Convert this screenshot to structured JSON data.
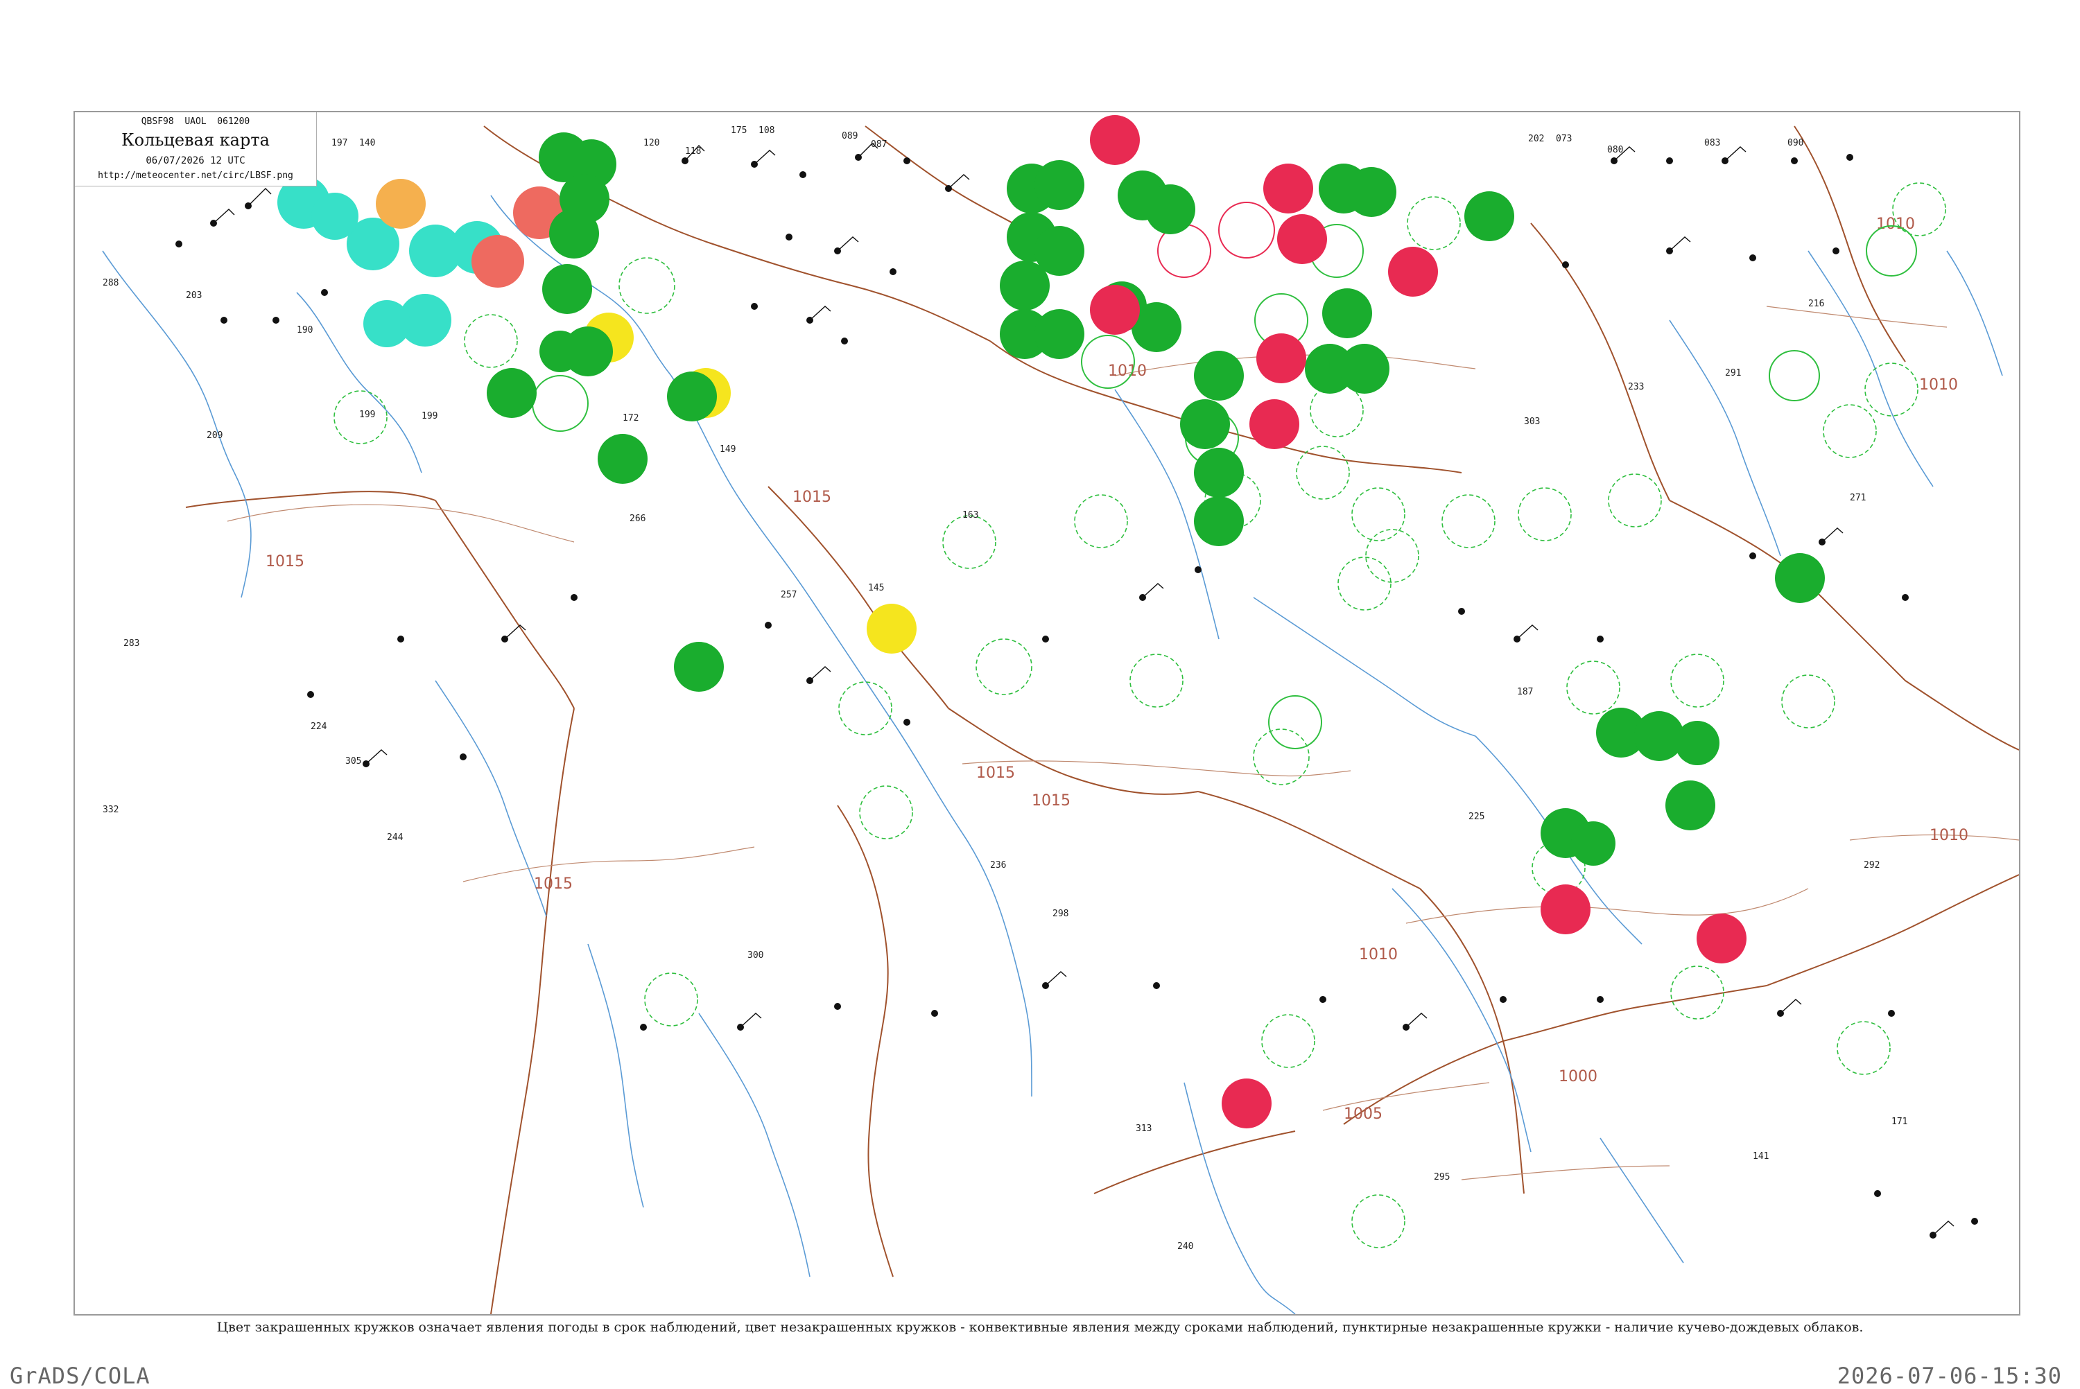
{
  "header": {
    "code_line": "QBSF98  UAOL  061200",
    "title": "Кольцевая карта",
    "datetime": "06/07/2026 12 UTC",
    "url": "http://meteocenter.net/circ/LBSF.png"
  },
  "caption": "Цвет закрашенных кружков означает явления погоды в срок наблюдений, цвет незакрашенных кружков - конвективные явления между сроками наблюдений, пунктирные незакрашенные кружки - наличие кучево-дождевых облаков.",
  "footer": {
    "left": "GrADS/COLA",
    "right": "2026-07-06-15:30"
  },
  "isobar_labels": [
    "1015",
    "1015",
    "1015",
    "1015",
    "1015",
    "1010",
    "1010",
    "1010",
    "1010",
    "1010",
    "1005",
    "1000"
  ],
  "station_values": [
    "197",
    "140",
    "120",
    "118",
    "175",
    "108",
    "089",
    "087",
    "202",
    "073",
    "080",
    "083",
    "090",
    "288",
    "203",
    "190",
    "199",
    "209",
    "172",
    "149",
    "163",
    "257",
    "145",
    "266",
    "244",
    "224",
    "199",
    "305",
    "283",
    "332",
    "300",
    "298",
    "225",
    "187",
    "303",
    "233",
    "291",
    "216",
    "271",
    "292",
    "171",
    "141",
    "295",
    "240",
    "313",
    "236"
  ],
  "colors": {
    "green": "#1aad2e",
    "red": "#e82a52",
    "cyan": "#37e0c8",
    "orange": "#f5b04e",
    "salmon": "#ee6a60",
    "yellow": "#f5e51e",
    "river": "#5b9bd5",
    "border": "#a0522d",
    "isobar_text": "#b05a4a"
  }
}
